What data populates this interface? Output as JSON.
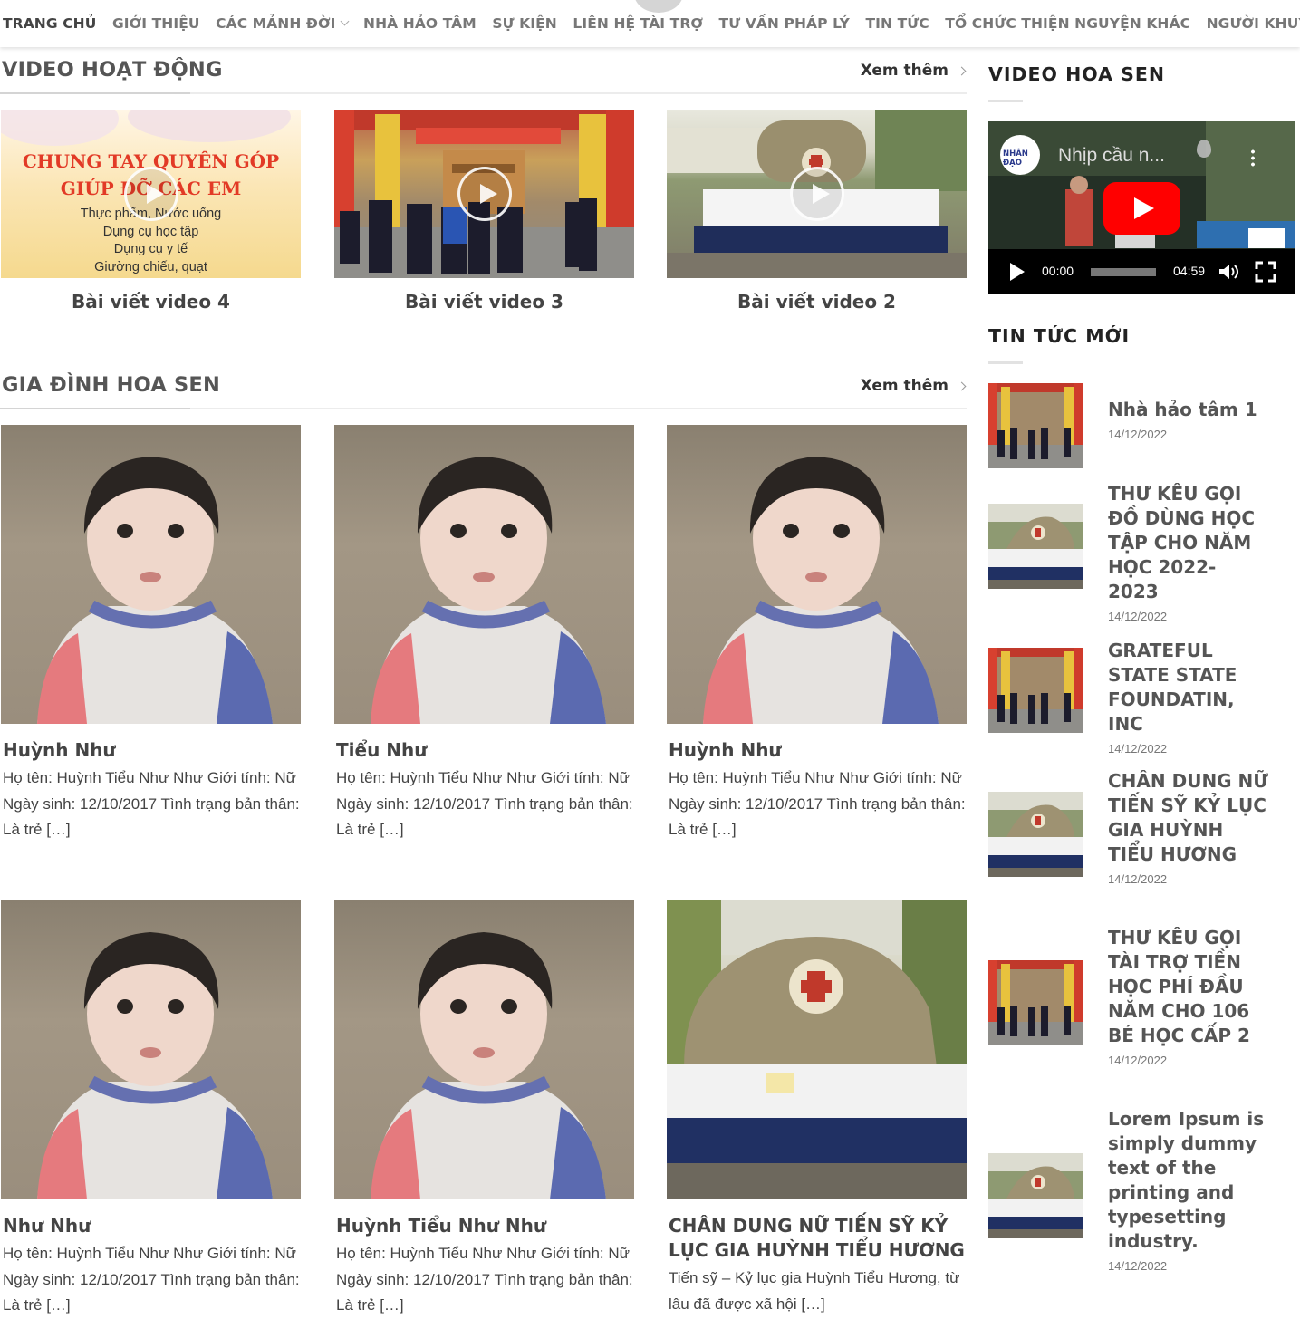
{
  "nav": {
    "items": [
      {
        "label": "TRANG CHỦ",
        "active": true
      },
      {
        "label": "GIỚI THIỆU"
      },
      {
        "label": "CÁC MẢNH ĐỜI",
        "has_dropdown": true
      },
      {
        "label": "NHÀ HẢO TÂM"
      },
      {
        "label": "SỰ KIỆN"
      },
      {
        "label": "LIÊN HỆ TÀI TRỢ"
      },
      {
        "label": "TƯ VẤN PHÁP LÝ"
      },
      {
        "label": "TIN TỨC"
      },
      {
        "label": "TỔ CHỨC THIỆN NGUYỆN KHÁC"
      },
      {
        "label": "NGƯỜI KHUYẾT TẬT"
      }
    ]
  },
  "video_section": {
    "title": "VIDEO HOẠT ĐỘNG",
    "more": "Xem thêm",
    "cards": [
      {
        "title": "Bài viết video 4",
        "poster_lines": [
          "CHUNG TAY QUYÊN GÓP",
          "GIÚP ĐỠ CÁC EM",
          "Thực phẩm, Nước uống",
          "Dụng cụ học tập",
          "Dụng cụ y tế",
          "Giường chiếu, quạt"
        ]
      },
      {
        "title": "Bài viết video 3"
      },
      {
        "title": "Bài viết video 2"
      }
    ]
  },
  "family_section": {
    "title": "GIA ĐÌNH HOA SEN",
    "more": "Xem thêm",
    "cards": [
      {
        "name": "Huỳnh Như",
        "excerpt": "Họ tên: Huỳnh Tiểu Như Như Giới tính: Nữ Ngày sinh: 12/10/2017 Tình trạng bản thân: Là trẻ […]"
      },
      {
        "name": "Tiểu Như",
        "excerpt": "Họ tên: Huỳnh Tiểu Như Như Giới tính: Nữ Ngày sinh: 12/10/2017 Tình trạng bản thân: Là trẻ […]"
      },
      {
        "name": "Huỳnh Như",
        "excerpt": "Họ tên: Huỳnh Tiểu Như Như Giới tính: Nữ Ngày sinh: 12/10/2017 Tình trạng bản thân: Là trẻ […]"
      },
      {
        "name": "Như Như",
        "excerpt": "Họ tên: Huỳnh Tiểu Như Như Giới tính: Nữ Ngày sinh: 12/10/2017 Tình trạng bản thân: Là trẻ […]"
      },
      {
        "name": "Huỳnh Tiểu Như Như",
        "excerpt": "Họ tên: Huỳnh Tiểu Như Như Giới tính: Nữ Ngày sinh: 12/10/2017 Tình trạng bản thân: Là trẻ […]"
      },
      {
        "name": "CHÂN DUNG NỮ TIẾN SỸ KỶ LỤC GIA HUỲNH TIỂU HƯƠNG",
        "excerpt": "Tiến sỹ – Kỷ lục gia Huỳnh Tiểu Hương, từ lâu đã được xã hội […]"
      }
    ]
  },
  "sidebar": {
    "video_title": "VIDEO HOA SEN",
    "video": {
      "logo_text": "NHÂN ĐẠO",
      "title": "Nhịp cầu n...",
      "time_current": "00:00",
      "time_total": "04:59"
    },
    "news_title": "TIN TỨC MỚI",
    "news": [
      {
        "title": "Nhà hảo tâm 1",
        "date": "14/12/2022",
        "thumb": "gate"
      },
      {
        "title": "THƯ KÊU GỌI ĐỒ DÙNG HỌC TẬP CHO NĂM HỌC 2022- 2023",
        "date": "14/12/2022",
        "thumb": "school"
      },
      {
        "title": "GRATEFUL STATE STATE FOUNDATIN, INC",
        "date": "14/12/2022",
        "thumb": "gate"
      },
      {
        "title": "CHÂN DUNG NỮ TIẾN SỸ KỶ LỤC GIA HUỲNH TIỂU HƯƠNG",
        "date": "14/12/2022",
        "thumb": "school"
      },
      {
        "title": "THƯ KÊU GỌI TÀI TRỢ TIỀN HỌC PHÍ ĐẦU NĂM CHO 106 BÉ HỌC CẤP 2",
        "date": "14/12/2022",
        "thumb": "gate"
      },
      {
        "title": "Lorem Ipsum is simply dummy text of the printing and typesetting industry.",
        "date": "14/12/2022",
        "thumb": "school"
      }
    ]
  }
}
